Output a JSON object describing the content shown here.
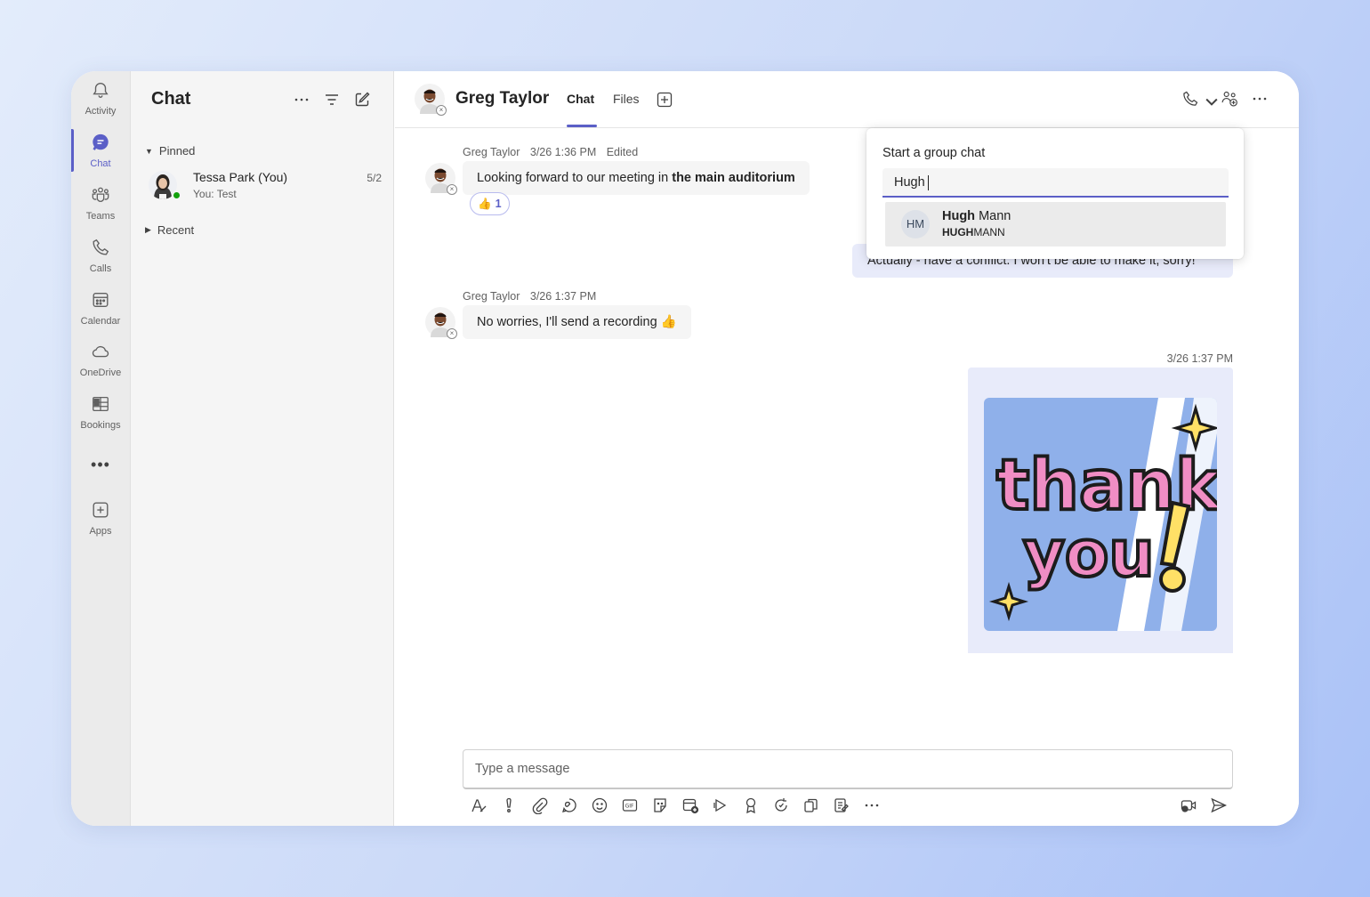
{
  "rail": {
    "items": [
      {
        "label": "Activity",
        "icon": "bell-icon"
      },
      {
        "label": "Chat",
        "icon": "chat-icon",
        "active": true
      },
      {
        "label": "Teams",
        "icon": "teams-icon"
      },
      {
        "label": "Calls",
        "icon": "phone-icon"
      },
      {
        "label": "Calendar",
        "icon": "calendar-icon"
      },
      {
        "label": "OneDrive",
        "icon": "cloud-icon"
      },
      {
        "label": "Bookings",
        "icon": "bookings-icon"
      },
      {
        "label": "",
        "icon": "more-icon"
      },
      {
        "label": "Apps",
        "icon": "add-app-icon"
      }
    ]
  },
  "chatlist": {
    "title": "Chat",
    "pinned_label": "Pinned",
    "recent_label": "Recent",
    "pinned_items": [
      {
        "name": "Tessa Park (You)",
        "preview": "You: Test",
        "date": "5/2"
      }
    ]
  },
  "header": {
    "name": "Greg Taylor",
    "tabs": [
      {
        "label": "Chat",
        "active": true
      },
      {
        "label": "Files"
      }
    ]
  },
  "messages": {
    "m1": {
      "sender": "Greg Taylor",
      "time": "3/26 1:36 PM",
      "edited": "Edited",
      "text_prefix": "Looking forward to our meeting in ",
      "text_bold": "the main auditorium",
      "reaction": "👍",
      "reaction_count": "1"
    },
    "m2": {
      "text": "Actually - have a conflict. I won't be able to make it, sorry!"
    },
    "m3": {
      "sender": "Greg Taylor",
      "time": "3/26 1:37 PM",
      "text": "No worries, I'll send a recording 👍"
    },
    "m4": {
      "time": "3/26 1:37 PM",
      "sticker_text": "thank you!"
    }
  },
  "compose": {
    "placeholder": "Type a message"
  },
  "popup": {
    "title": "Start a group chat",
    "input_value": "Hugh",
    "suggestion": {
      "initials": "HM",
      "name_bold": "Hugh",
      "name_rest": " Mann",
      "sub_bold": "HUGH",
      "sub_rest": "MANN"
    }
  },
  "colors": {
    "accent": "#5b5fc7",
    "mine_bubble": "#e8ebfa",
    "presence": "#13a10e"
  }
}
